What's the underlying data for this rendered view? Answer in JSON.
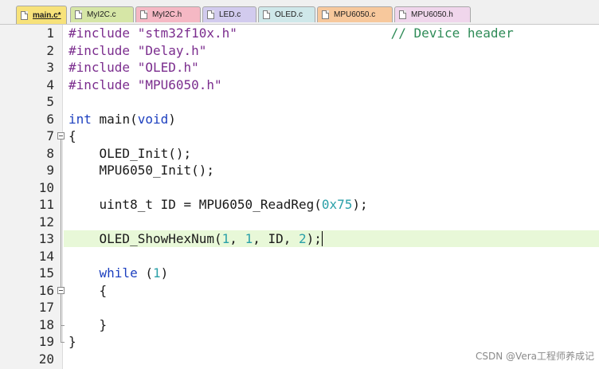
{
  "tabs": [
    {
      "label": "main.c*",
      "color": "#f7e27a",
      "active": true
    },
    {
      "label": "MyI2C.c",
      "color": "#d6e6a6"
    },
    {
      "label": "MyI2C.h",
      "color": "#f5b8c4"
    },
    {
      "label": "LED.c",
      "color": "#d2cbee"
    },
    {
      "label": "OLED.c",
      "color": "#cfe8ea"
    },
    {
      "label": "MPU6050.c",
      "color": "#f7c89c"
    },
    {
      "label": "MPU6050.h",
      "color": "#f0d6ec"
    }
  ],
  "lines": [
    {
      "num": "1",
      "tokens": [
        {
          "t": "#include ",
          "c": "k-pre"
        },
        {
          "t": "\"stm32f10x.h\"",
          "c": "k-str"
        },
        {
          "t": "                    ",
          "c": "k-def"
        },
        {
          "t": "// Device header",
          "c": "k-com"
        }
      ]
    },
    {
      "num": "2",
      "tokens": [
        {
          "t": "#include ",
          "c": "k-pre"
        },
        {
          "t": "\"Delay.h\"",
          "c": "k-str"
        }
      ]
    },
    {
      "num": "3",
      "tokens": [
        {
          "t": "#include ",
          "c": "k-pre"
        },
        {
          "t": "\"OLED.h\"",
          "c": "k-str"
        }
      ]
    },
    {
      "num": "4",
      "tokens": [
        {
          "t": "#include ",
          "c": "k-pre"
        },
        {
          "t": "\"MPU6050.h\"",
          "c": "k-str"
        }
      ]
    },
    {
      "num": "5",
      "tokens": []
    },
    {
      "num": "6",
      "tokens": [
        {
          "t": "int",
          "c": "k-kw"
        },
        {
          "t": " main(",
          "c": "k-def"
        },
        {
          "t": "void",
          "c": "k-kw"
        },
        {
          "t": ")",
          "c": "k-def"
        }
      ]
    },
    {
      "num": "7",
      "tokens": [
        {
          "t": "{",
          "c": "k-def"
        }
      ]
    },
    {
      "num": "8",
      "tokens": [
        {
          "t": "    OLED_Init();",
          "c": "k-def"
        }
      ]
    },
    {
      "num": "9",
      "tokens": [
        {
          "t": "    MPU6050_Init();",
          "c": "k-def"
        }
      ]
    },
    {
      "num": "10",
      "tokens": []
    },
    {
      "num": "11",
      "tokens": [
        {
          "t": "    uint8_t ID = MPU6050_ReadReg(",
          "c": "k-def"
        },
        {
          "t": "0x75",
          "c": "k-num"
        },
        {
          "t": ");",
          "c": "k-def"
        }
      ]
    },
    {
      "num": "12",
      "tokens": []
    },
    {
      "num": "13",
      "tokens": [
        {
          "t": "    OLED_ShowHexNum(",
          "c": "k-def"
        },
        {
          "t": "1",
          "c": "k-num"
        },
        {
          "t": ", ",
          "c": "k-def"
        },
        {
          "t": "1",
          "c": "k-num"
        },
        {
          "t": ", ID, ",
          "c": "k-def"
        },
        {
          "t": "2",
          "c": "k-num"
        },
        {
          "t": ");",
          "c": "k-def"
        }
      ],
      "current": true
    },
    {
      "num": "14",
      "tokens": []
    },
    {
      "num": "15",
      "tokens": [
        {
          "t": "    ",
          "c": "k-def"
        },
        {
          "t": "while",
          "c": "k-kw"
        },
        {
          "t": " (",
          "c": "k-def"
        },
        {
          "t": "1",
          "c": "k-num"
        },
        {
          "t": ")",
          "c": "k-def"
        }
      ]
    },
    {
      "num": "16",
      "tokens": [
        {
          "t": "    {",
          "c": "k-def"
        }
      ]
    },
    {
      "num": "17",
      "tokens": []
    },
    {
      "num": "18",
      "tokens": [
        {
          "t": "    }",
          "c": "k-def"
        }
      ]
    },
    {
      "num": "19",
      "tokens": [
        {
          "t": "}",
          "c": "k-def"
        }
      ]
    },
    {
      "num": "20",
      "tokens": []
    }
  ],
  "watermark": "CSDN @Vera工程师养成记"
}
